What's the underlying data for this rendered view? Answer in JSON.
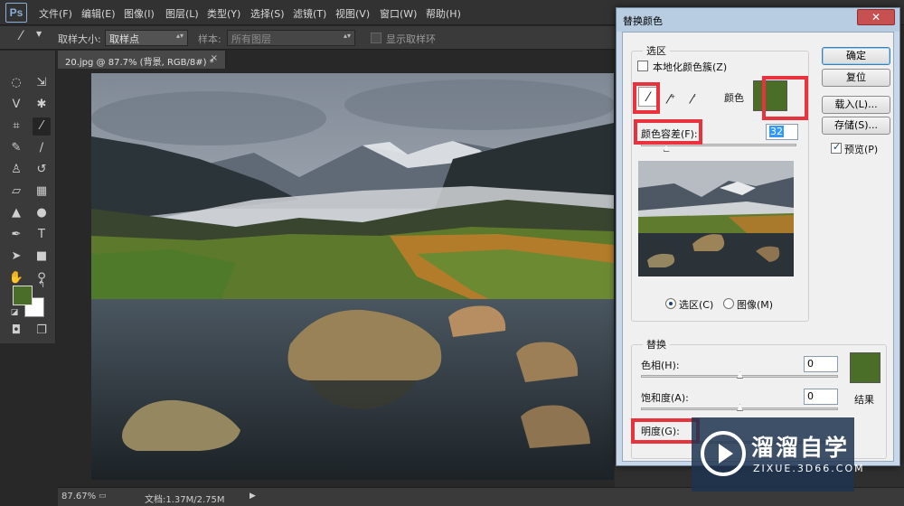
{
  "app": {
    "logo": "Ps"
  },
  "menu": [
    "文件(F)",
    "编辑(E)",
    "图像(I)",
    "图层(L)",
    "类型(Y)",
    "选择(S)",
    "滤镜(T)",
    "视图(V)",
    "窗口(W)",
    "帮助(H)"
  ],
  "options_bar": {
    "tool_icon": "eyedropper-icon",
    "sample_size_label": "取样大小:",
    "sample_size_value": "取样点",
    "sample_label": "样本:",
    "sample_value": "所有图层",
    "show_ring_label": "显示取样环"
  },
  "document": {
    "tab_title": "20.jpg @ 87.7% (背景, RGB/8#) *",
    "close_glyph": "×",
    "zoom": "87.67%",
    "doc_info": "文档:1.37M/2.75M"
  },
  "dialog": {
    "title": "替换颜色",
    "close_glyph": "✕",
    "selection": {
      "legend": "选区",
      "localized_clusters_label": "本地化颜色簇(Z)",
      "localized_clusters_checked": false,
      "color_label": "颜色",
      "color_hex": "#4a6e28",
      "fuzziness_label": "颜色容差(F):",
      "fuzziness_value": "32",
      "fuzziness_fraction": 0.16,
      "view_selection_label": "选区(C)",
      "view_image_label": "图像(M)",
      "view_mode": "selection"
    },
    "replacement": {
      "legend": "替换",
      "hue_label": "色相(H):",
      "hue_value": "0",
      "saturation_label": "饱和度(A):",
      "saturation_value": "0",
      "lightness_label": "明度(G):",
      "result_label": "结果",
      "result_hex": "#4a6e28"
    },
    "buttons": {
      "ok": "确定",
      "reset": "复位",
      "load": "载入(L)...",
      "save": "存储(S)...",
      "preview_label": "预览(P)",
      "preview_checked": true
    }
  },
  "watermark": {
    "name": "溜溜自学",
    "url": "ZIXUE.3D66.COM"
  },
  "colors": {
    "foreground": "#4a6e28",
    "background": "#ffffff",
    "highlight": "#e8333f"
  }
}
